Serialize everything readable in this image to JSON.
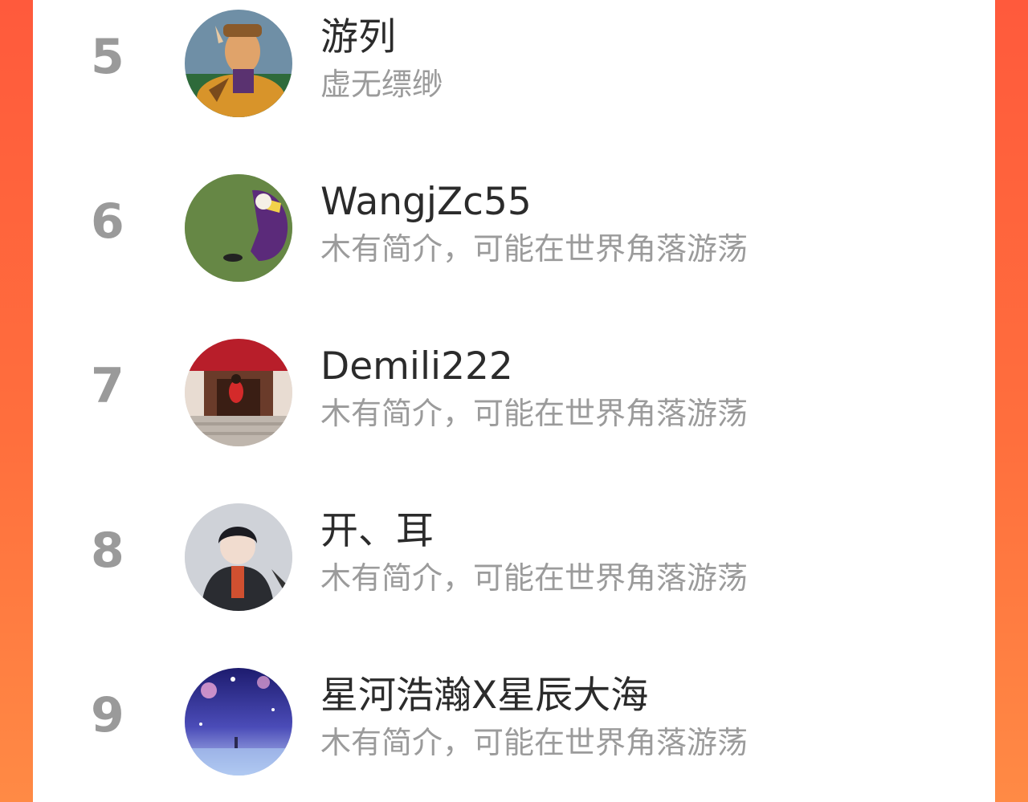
{
  "ranking": {
    "items": [
      {
        "rank": "5",
        "name": "游列",
        "bio": "虚无缥缈",
        "avatar_icon": "character-avatar-icon"
      },
      {
        "rank": "6",
        "name": "WangjZc55",
        "bio": "木有简介，可能在世界角落游荡",
        "avatar_icon": "grass-field-avatar-icon"
      },
      {
        "rank": "7",
        "name": "Demili222",
        "bio": "木有简介，可能在世界角落游荡",
        "avatar_icon": "red-doorway-avatar-icon"
      },
      {
        "rank": "8",
        "name": "开、耳",
        "bio": "木有简介，可能在世界角落游荡",
        "avatar_icon": "anime-boy-avatar-icon"
      },
      {
        "rank": "9",
        "name": "星河浩瀚X星辰大海",
        "bio": "木有简介，可能在世界角落游荡",
        "avatar_icon": "starry-sky-avatar-icon"
      }
    ]
  },
  "colors": {
    "background_left": "#ff5a3c",
    "background_right": "#ff8a45",
    "panel": "#ffffff",
    "rank_text": "#9a9a9a",
    "name_text": "#2b2b2b",
    "bio_text": "#9b9b9b"
  }
}
